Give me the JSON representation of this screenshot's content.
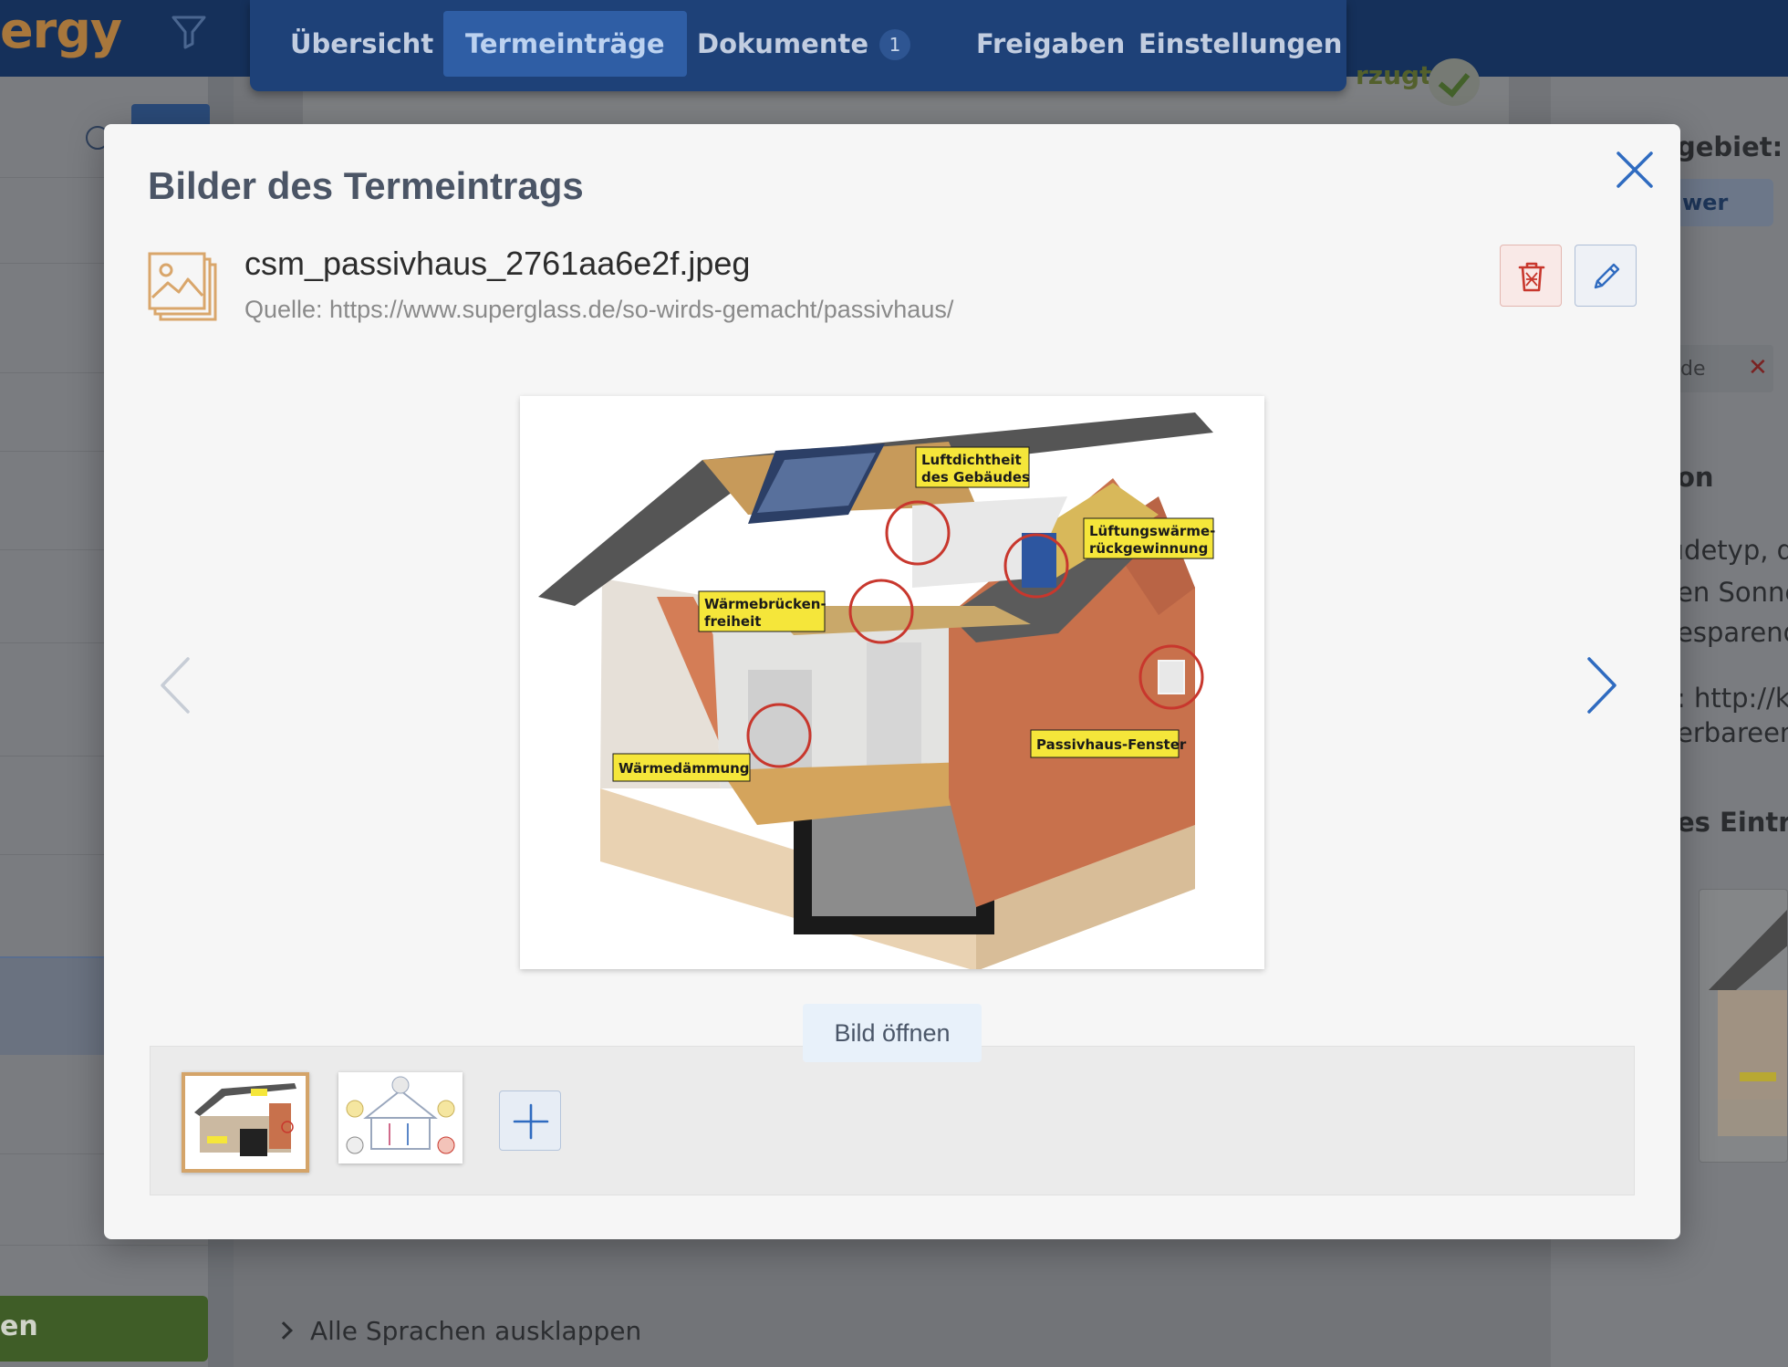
{
  "app": {
    "brand_partial": "ergy",
    "verified_partial": "rzugt",
    "expand_languages": "Alle Sprachen ausklappen",
    "left_button_partial": "en"
  },
  "nav": {
    "tabs": [
      {
        "label": "Übersicht",
        "active": false
      },
      {
        "label": "Termeinträge",
        "active": true
      },
      {
        "label": "Dokumente",
        "active": false,
        "badge": "1"
      },
      {
        "label": "Freigaben",
        "active": false
      },
      {
        "label": "Einstellungen",
        "active": false
      }
    ]
  },
  "right_panel": {
    "heading_partial": "gebiet:",
    "tag_partial": "wer",
    "chip_partial": "de",
    "section_partial": "on",
    "text_lines": [
      "ıdetyp, d",
      "en Sonne",
      "esparend"
    ],
    "link_lines": [
      ": http://kc",
      "erbareene"
    ],
    "images_heading_partial": "es Eintra"
  },
  "modal": {
    "title": "Bilder des Termeintrags",
    "file_name": "csm_passivhaus_2761aa6e2f.jpeg",
    "source": "Quelle: https://www.superglass.de/so-wirds-gemacht/passivhaus/",
    "open_button": "Bild öffnen",
    "image_labels": {
      "luftdichtheit_1": "Luftdichtheit",
      "luftdichtheit_2": "des Gebäudes",
      "lueftung_1": "Lüftungswärme-",
      "lueftung_2": "rückgewinnung",
      "waermebruecken_1": "Wärmebrücken-",
      "waermebruecken_2": "freiheit",
      "waermedaemmung": "Wärmedämmung",
      "fenster": "Passivhaus-Fenster"
    },
    "thumbnails": [
      {
        "selected": true
      },
      {
        "selected": false
      }
    ]
  },
  "colors": {
    "nav_bg": "#1e4178",
    "nav_active": "#2f5ea5",
    "accent_blue": "#2f6bc0",
    "thumb_selected_border": "#d4a469",
    "delete_red": "#c8372d",
    "modal_bg": "#f6f6f6"
  }
}
